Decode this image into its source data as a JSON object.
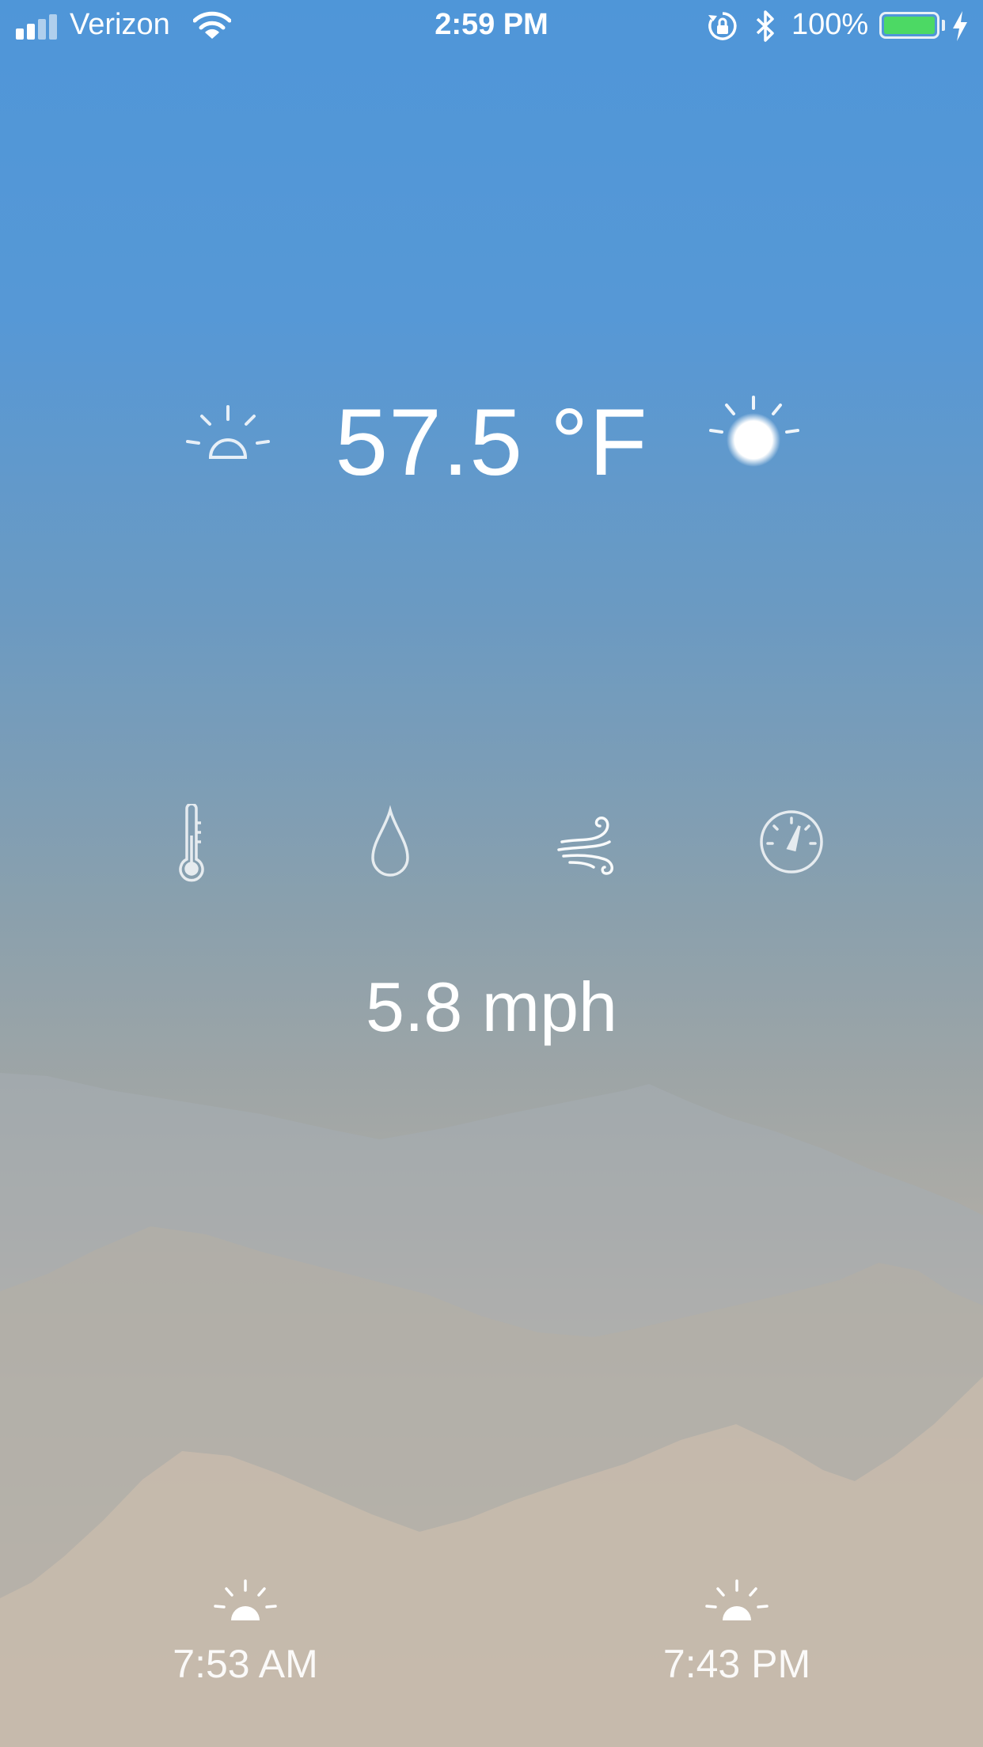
{
  "status_bar": {
    "carrier": "Verizon",
    "time": "2:59 PM",
    "battery_percent": "100%",
    "battery_color": "#4cd964",
    "icons": [
      "signal-icon",
      "wifi-icon",
      "orientation-lock-icon",
      "bluetooth-icon",
      "battery-icon",
      "charging-icon"
    ]
  },
  "weather": {
    "temperature": "57.5 °F",
    "left_icon": "sunrise-outline-icon",
    "right_icon": "sun-icon"
  },
  "metrics": {
    "items": [
      {
        "icon": "thermometer-icon"
      },
      {
        "icon": "humidity-drop-icon"
      },
      {
        "icon": "wind-icon"
      },
      {
        "icon": "pressure-gauge-icon"
      }
    ],
    "current_value": "5.8 mph"
  },
  "sun_times": {
    "sunrise": "7:53 AM",
    "sunset": "7:43 PM"
  }
}
